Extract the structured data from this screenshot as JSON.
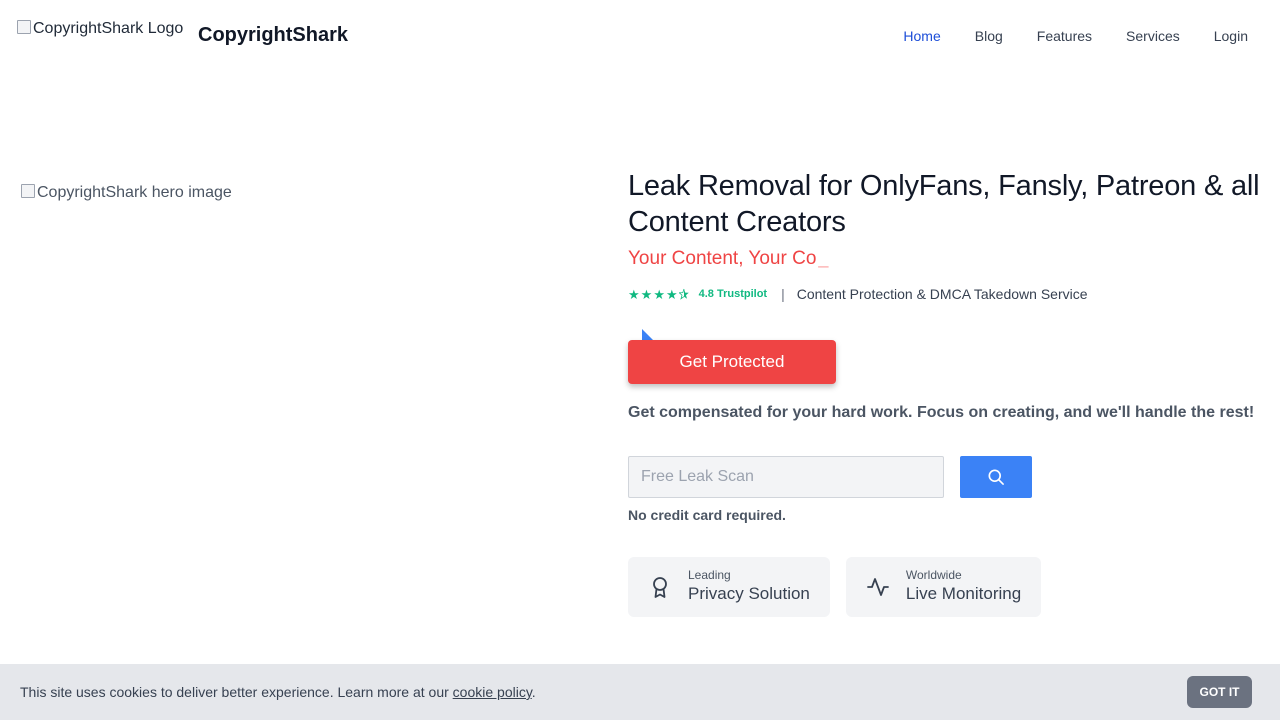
{
  "header": {
    "logo_alt": "CopyrightShark Logo",
    "brand": "CopyrightShark",
    "nav": [
      "Home",
      "Blog",
      "Features",
      "Services",
      "Login"
    ]
  },
  "hero": {
    "image_alt": "CopyrightShark hero image",
    "title": "Leak Removal for OnlyFans, Fansly, Patreon & all Content Creators",
    "typed_text": "Your Content, Your Co",
    "typed_cursor": "_",
    "rating_value": 4.5,
    "rating_label": "4.8 Trustpilot",
    "separator": "|",
    "tagline": "Content Protection & DMCA Takedown Service",
    "cta_label": "Get Protected",
    "subcopy": "Get compensated for your hard work. Focus on creating, and we'll handle the rest!",
    "scan_placeholder": "Free Leak Scan",
    "scan_value": "",
    "no_cc": "No credit card required.",
    "badges": [
      {
        "small": "Leading",
        "big": "Privacy Solution",
        "icon": "award-icon"
      },
      {
        "small": "Worldwide",
        "big": "Live Monitoring",
        "icon": "activity-icon"
      }
    ]
  },
  "cookie": {
    "text": "This site uses cookies to deliver better experience. Learn more at our ",
    "link": "cookie policy",
    "period": ".",
    "button": "GOT IT"
  },
  "colors": {
    "accent_red": "#ef4444",
    "accent_blue": "#3b82f6",
    "nav_active": "#1d4ed8",
    "trustpilot_green": "#10b981"
  }
}
